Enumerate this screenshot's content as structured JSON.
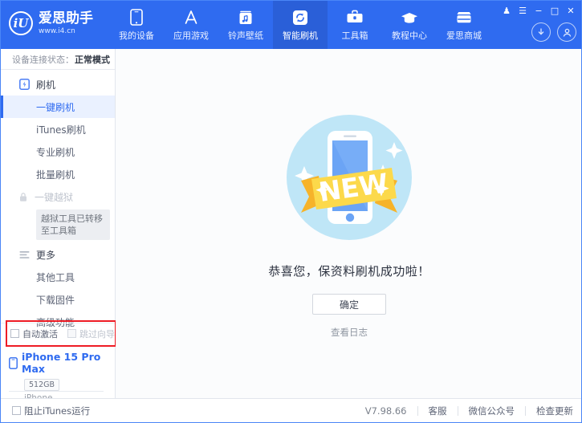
{
  "header": {
    "logo_title": "爱思助手",
    "logo_sub": "www.i4.cn",
    "logo_mark": "iU",
    "nav": [
      {
        "label": "我的设备",
        "icon": "phone-icon",
        "active": false
      },
      {
        "label": "应用游戏",
        "icon": "appstore-icon",
        "active": false
      },
      {
        "label": "铃声壁纸",
        "icon": "music-icon",
        "active": false
      },
      {
        "label": "智能刷机",
        "icon": "refresh-icon",
        "active": true
      },
      {
        "label": "工具箱",
        "icon": "toolbox-icon",
        "active": false
      },
      {
        "label": "教程中心",
        "icon": "graduation-cap-icon",
        "active": false
      },
      {
        "label": "爱思商城",
        "icon": "store-icon",
        "active": false
      }
    ],
    "window_controls": [
      {
        "name": "theme-shirt-icon",
        "glyph": "♟"
      },
      {
        "name": "menu-icon",
        "glyph": "☰"
      },
      {
        "name": "minimize-icon",
        "glyph": "−"
      },
      {
        "name": "maximize-icon",
        "glyph": "□"
      },
      {
        "name": "close-icon",
        "glyph": "✕"
      }
    ],
    "actions": [
      {
        "name": "download-icon"
      },
      {
        "name": "account-icon"
      }
    ]
  },
  "sidebar": {
    "connection_label": "设备连接状态：",
    "connection_value": "正常模式",
    "sections": [
      {
        "title": "刷机",
        "icon": "flash-phone-icon",
        "items": [
          {
            "label": "一键刷机",
            "state": "selected"
          },
          {
            "label": "iTunes刷机",
            "state": "normal"
          },
          {
            "label": "专业刷机",
            "state": "normal"
          },
          {
            "label": "批量刷机",
            "state": "normal"
          },
          {
            "label": "一键越狱",
            "state": "disabled",
            "tooltip": "越狱工具已转移至工具箱"
          }
        ]
      },
      {
        "title": "更多",
        "icon": "list-icon",
        "items": [
          {
            "label": "其他工具",
            "state": "normal"
          },
          {
            "label": "下载固件",
            "state": "normal"
          },
          {
            "label": "高级功能",
            "state": "normal"
          }
        ]
      }
    ],
    "options": [
      {
        "label": "自动激活",
        "checked": false,
        "disabled": false
      },
      {
        "label": "跳过向导",
        "checked": false,
        "disabled": true
      }
    ],
    "device": {
      "name": "iPhone 15 Pro Max",
      "capacity": "512GB",
      "type": "iPhone",
      "icon": "phone-icon"
    }
  },
  "main": {
    "illustration": "new-phone-badge-illustration",
    "message": "恭喜您，保资料刷机成功啦！",
    "confirm_label": "确定",
    "log_link": "查看日志"
  },
  "statusbar": {
    "block_itunes_label": "阻止iTunes运行",
    "block_itunes_checked": false,
    "version": "V7.98.66",
    "links": [
      "客服",
      "微信公众号",
      "检查更新"
    ]
  },
  "colors": {
    "header_blue": "#2f6bf0",
    "active_nav": "#2a5fd8",
    "accent": "#2f6bf0",
    "annotation_red": "#ee1c25",
    "selected_bg": "#eaf1ff"
  }
}
